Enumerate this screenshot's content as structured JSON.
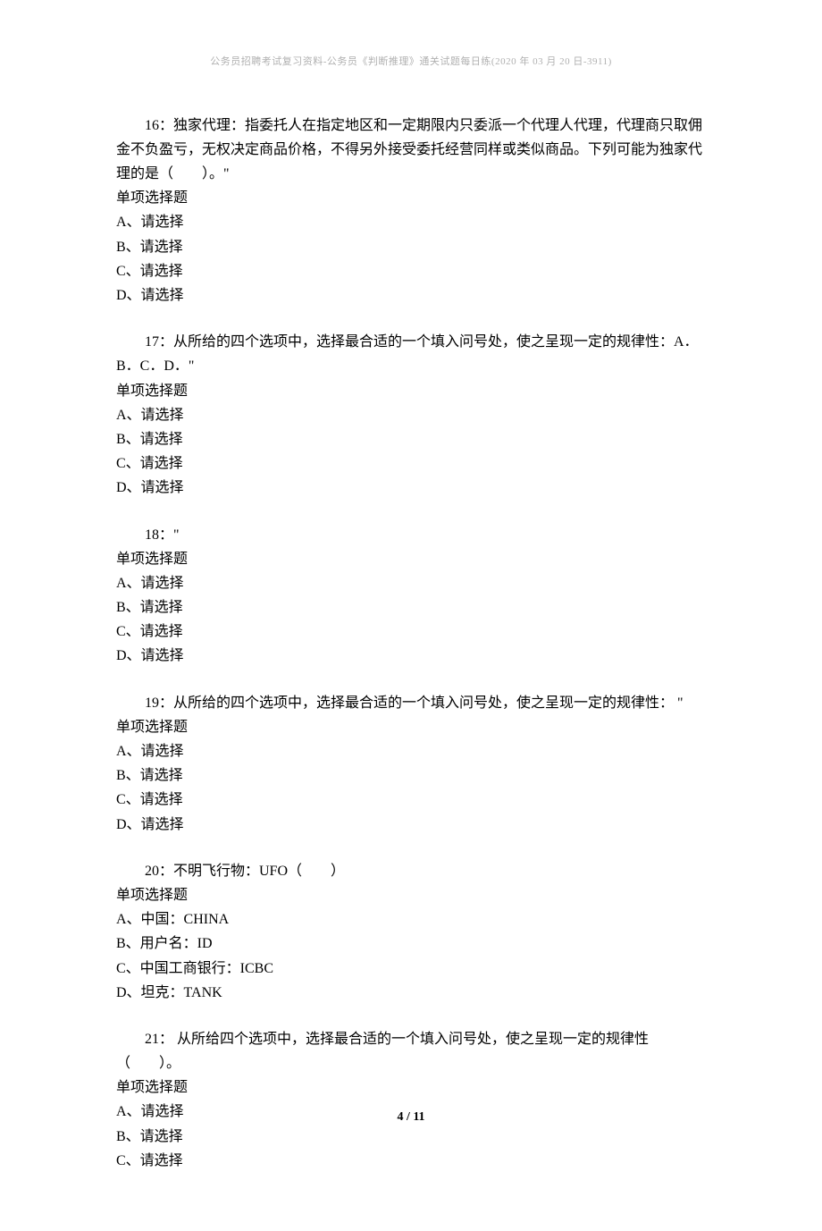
{
  "header": "公务员招聘考试复习资料-公务员《判断推理》通关试题每日练(2020 年 03 月 20 日-3911)",
  "questions": [
    {
      "number": "16",
      "text": "：独家代理：指委托人在指定地区和一定期限内只委派一个代理人代理，代理商只取佣金不负盈亏，无权决定商品价格，不得另外接受委托经营同样或类似商品。下列可能为独家代理的是（　　）。\"",
      "type": "单项选择题",
      "options": [
        "A、请选择",
        "B、请选择",
        "C、请选择",
        "D、请选择"
      ]
    },
    {
      "number": "17",
      "text": "：从所给的四个选项中，选择最合适的一个填入问号处，使之呈现一定的规律性：A．B．C．D．\"",
      "type": "单项选择题",
      "options": [
        "A、请选择",
        "B、请选择",
        "C、请选择",
        "D、请选择"
      ]
    },
    {
      "number": "18",
      "text": "：\"",
      "type": "单项选择题",
      "options": [
        "A、请选择",
        "B、请选择",
        "C、请选择",
        "D、请选择"
      ]
    },
    {
      "number": "19",
      "text": "：从所给的四个选项中，选择最合适的一个填入问号处，使之呈现一定的规律性： \"",
      "type": "单项选择题",
      "options": [
        "A、请选择",
        "B、请选择",
        "C、请选择",
        "D、请选择"
      ]
    },
    {
      "number": "20",
      "text": "：不明飞行物：UFO（　　）",
      "type": "单项选择题",
      "options": [
        "A、中国：CHINA",
        "B、用户名：ID",
        "C、中国工商银行：ICBC",
        "D、坦克：TANK"
      ]
    },
    {
      "number": "21",
      "text": "： 从所给四个选项中，选择最合适的一个填入问号处，使之呈现一定的规律性（　　）。",
      "type": "单项选择题",
      "options": [
        "A、请选择",
        "B、请选择",
        "C、请选择"
      ]
    }
  ],
  "pageNumber": "4 / 11"
}
